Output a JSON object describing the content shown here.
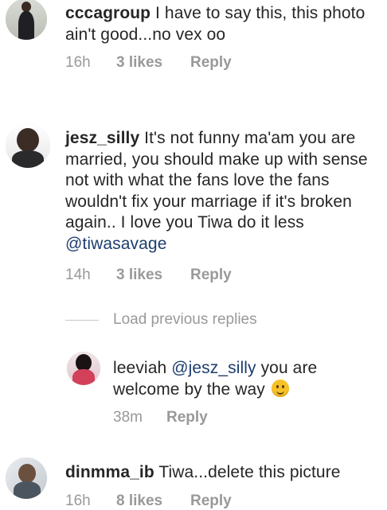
{
  "comments": [
    {
      "username": "cccagroup",
      "text": "I have to say this, this photo ain't good...no vex oo",
      "time": "16h",
      "likes": "3 likes",
      "reply": "Reply"
    },
    {
      "username": "jesz_silly",
      "text": "It's not funny ma'am you are married, you should make up with sense not with what the fans love the fans wouldn't fix your marriage if it's broken again.. I love you Tiwa do it less",
      "mention": "@tiwasavage",
      "time": "14h",
      "likes": "3 likes",
      "reply": "Reply"
    },
    {
      "username": "dinmma_ib",
      "text": "Tiwa...delete this picture",
      "time": "16h",
      "likes": "8 likes",
      "reply": "Reply"
    }
  ],
  "load_previous": "Load previous replies",
  "reply": {
    "username": "leeviah",
    "mention": "@jesz_silly",
    "text": "you are welcome by the way",
    "emoji": "slightly-smiling-face-icon",
    "time": "38m",
    "reply": "Reply"
  },
  "colors": {
    "text": "#262626",
    "meta": "#999999",
    "mention": "#1d3d6e",
    "background": "#ffffff"
  }
}
